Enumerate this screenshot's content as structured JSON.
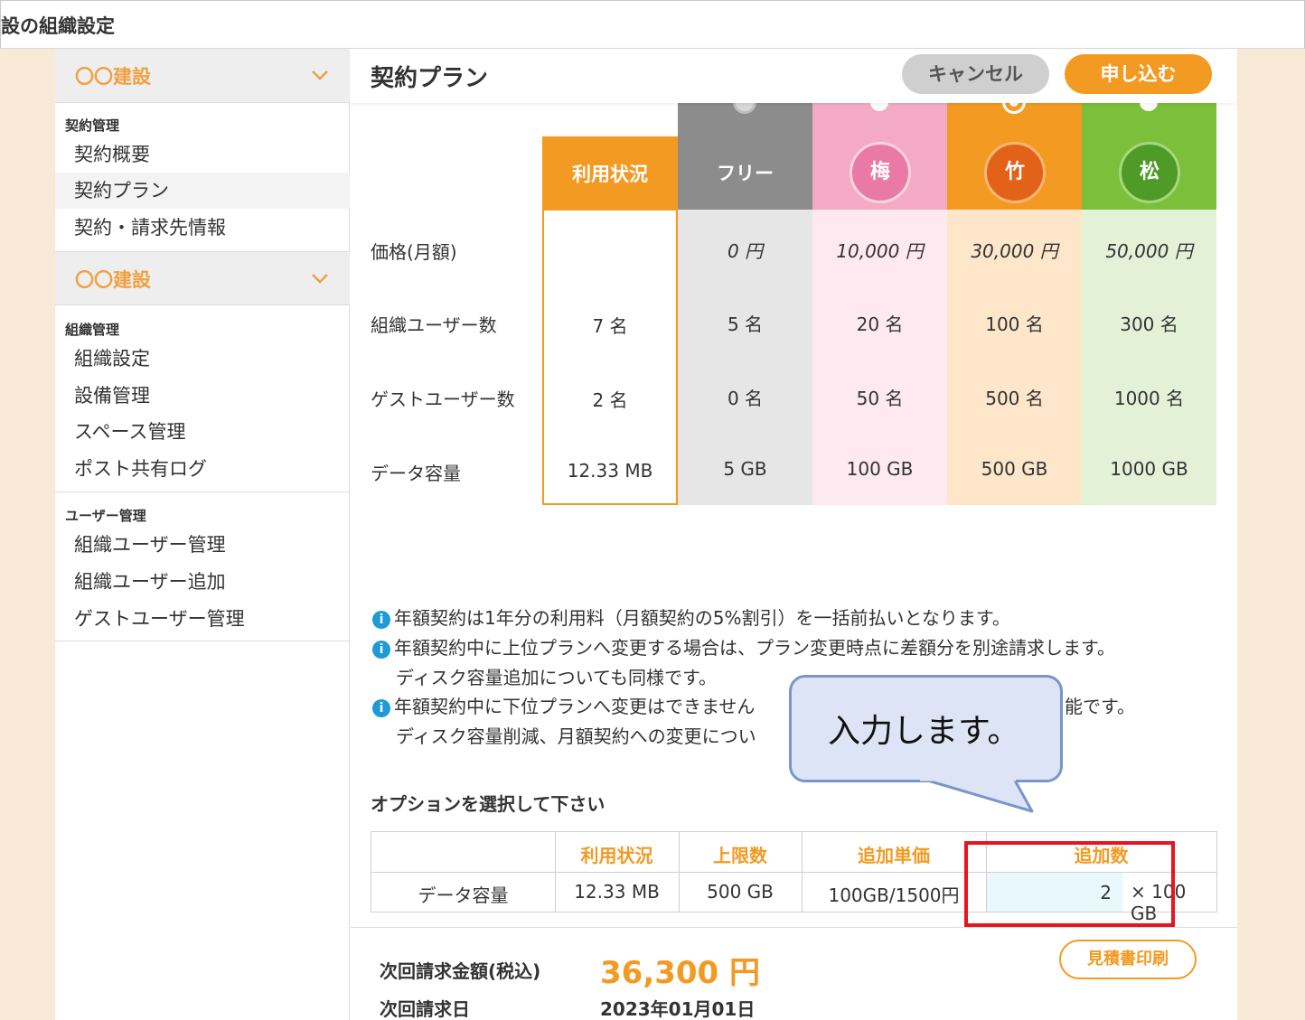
{
  "topbar": {
    "title": "設の組織設定"
  },
  "sidebar": {
    "org1": {
      "name": "〇〇建設"
    },
    "org2": {
      "name": "〇〇建設"
    },
    "sections": [
      {
        "label": "契約管理",
        "items": [
          "契約概要",
          "契約プラン",
          "契約・請求先情報"
        ]
      },
      {
        "label": "組織管理",
        "items": [
          "組織設定",
          "設備管理",
          "スペース管理",
          "ポスト共有ログ"
        ]
      },
      {
        "label": "ユーザー管理",
        "items": [
          "組織ユーザー管理",
          "組織ユーザー追加",
          "ゲストユーザー管理"
        ]
      }
    ],
    "active_item": "契約プラン"
  },
  "header": {
    "title": "契約プラン",
    "cancel_label": "キャンセル",
    "apply_label": "申し込む"
  },
  "plan_table": {
    "row_labels": [
      "価格(月額)",
      "組織ユーザー数",
      "ゲストユーザー数",
      "データ容量"
    ],
    "usage": {
      "label": "利用状況",
      "values": [
        "",
        "7 名",
        "2 名",
        "12.33 MB"
      ]
    },
    "plans": [
      {
        "name": "フリー",
        "badge": "",
        "values": [
          "0 円",
          "5 名",
          "0 名",
          "5 GB"
        ],
        "head_color": "#8c8c8c",
        "body_color": "#e6e6e6"
      },
      {
        "name": "梅",
        "badge": "梅",
        "values": [
          "10,000 円",
          "20 名",
          "50 名",
          "100 GB"
        ],
        "head_color": "#f4a9c4",
        "body_color": "#fde9ef"
      },
      {
        "name": "竹",
        "badge": "竹",
        "values": [
          "30,000 円",
          "100 名",
          "500 名",
          "500 GB"
        ],
        "head_color": "#f39a22",
        "body_color": "#fde6c9"
      },
      {
        "name": "松",
        "badge": "松",
        "values": [
          "50,000 円",
          "300 名",
          "1000 名",
          "1000 GB"
        ],
        "head_color": "#7bbf3a",
        "body_color": "#e3f2d6"
      }
    ],
    "selected_plan": "竹"
  },
  "notes": [
    "年額契約は1年分の利用料（月額契約の5%割引）を一括前払いとなります。",
    "年額契約中に上位プランへ変更する場合は、プラン変更時点に差額分を別途請求します。",
    "ディスク容量追加についても同様です。",
    "年額契約中に下位プランへ変更はできません",
    "能です。",
    "ディスク容量削減、月額契約への変更につい"
  ],
  "options": {
    "title": "オプションを選択して下さい",
    "headers": [
      "利用状況",
      "上限数",
      "追加単価",
      "追加数"
    ],
    "row": {
      "name": "データ容量",
      "usage": "12.33 MB",
      "limit": "500 GB",
      "unit_price": "100GB/1500円",
      "quantity": "2",
      "unit": "× 100 GB"
    }
  },
  "billing": {
    "amount_label": "次回請求金額(税込)",
    "amount": "36,300 円",
    "date_label": "次回請求日",
    "date": "2023年01月01日",
    "estimate_label": "見積書印刷"
  },
  "annotation": {
    "callout_text": "入力します。",
    "highlight_color": "#e8141e"
  }
}
